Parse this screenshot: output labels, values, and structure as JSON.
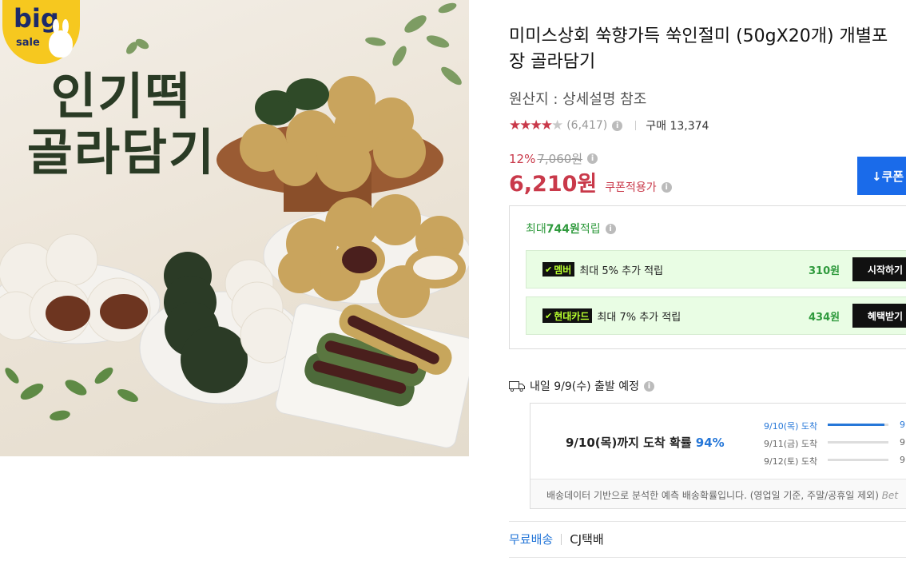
{
  "hero": {
    "badge_big": "big",
    "badge_sale": "sale",
    "title_line1": "인기떡",
    "title_line2": "골라담기"
  },
  "product": {
    "title": "미미스상회 쑥향가득 쑥인절미 (50gX20개) 개별포장 골라담기",
    "origin": "원산지 : 상세설명 참조",
    "stars_filled": "★★★★",
    "stars_half": "★",
    "review_count": "(6,417)",
    "purchase": "구매 13,374",
    "discount_pct": "12%",
    "original_price": "7,060원",
    "price": "6,210원",
    "coupon_note": "쿠폰적용가",
    "coupon_button": "↓쿠폰"
  },
  "reward": {
    "head_prefix": "최대 ",
    "head_amount": "744원",
    "head_suffix": " 적립",
    "rows": [
      {
        "tag": "멤버",
        "text": "최대 5% 추가 적립",
        "amount": "310원",
        "button": "시작하기"
      },
      {
        "tag": "현대카드",
        "text": "최대 7% 추가 적립",
        "amount": "434원",
        "button": "혜택받기"
      }
    ]
  },
  "shipping": {
    "label": "내일 9/9(수) 출발 예정",
    "main_prefix": "9/10(목)까지 도착 확률 ",
    "main_pct": "94%",
    "lines": [
      {
        "label": "9/10(목) 도착",
        "fill": 0.94,
        "value": "9"
      },
      {
        "label": "9/11(금) 도착",
        "fill": 0.0,
        "value": "9"
      },
      {
        "label": "9/12(토) 도착",
        "fill": 0.0,
        "value": "9"
      }
    ],
    "note": "배송데이터 기반으로 분석한 예측 배송확률입니다. (영업일 기준, 주말/공휴일 제외)",
    "note_logo": "Bet"
  },
  "delivery": {
    "free": "무료배송",
    "carrier": "CJ택배"
  },
  "colors": {
    "accent_red": "#c9394a",
    "accent_blue": "#2677d8",
    "coupon_blue": "#1a6bea",
    "reward_green": "#2f9a3d"
  }
}
